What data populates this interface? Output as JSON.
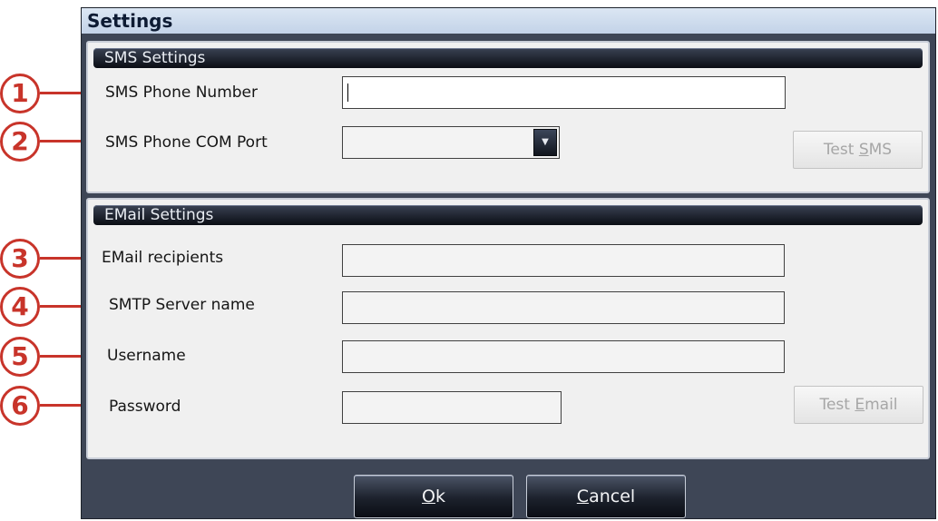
{
  "window": {
    "title": "Settings"
  },
  "callouts": [
    "1",
    "2",
    "3",
    "4",
    "5",
    "6"
  ],
  "sms": {
    "header": "SMS Settings",
    "phone_number_label": "SMS Phone Number",
    "phone_number_value": "",
    "com_port_label": "SMS Phone COM Port",
    "com_port_value": "",
    "test_button": {
      "pre": "Test ",
      "key": "S",
      "post": "MS"
    }
  },
  "email": {
    "header": "EMail Settings",
    "recipients_label": "EMail recipients",
    "smtp_label": "SMTP Server name",
    "username_label": "Username",
    "password_label": "Password",
    "test_button": {
      "pre": "Test ",
      "key": "E",
      "post": "mail"
    }
  },
  "footer": {
    "ok": {
      "key": "O",
      "post": "k"
    },
    "cancel": {
      "key": "C",
      "post": "ancel"
    }
  },
  "colors": {
    "dialog_bg": "#3e4656",
    "callout": "#c8342a",
    "group_bg": "#f0f0f0",
    "disabled_text": "#a6a6a6"
  }
}
